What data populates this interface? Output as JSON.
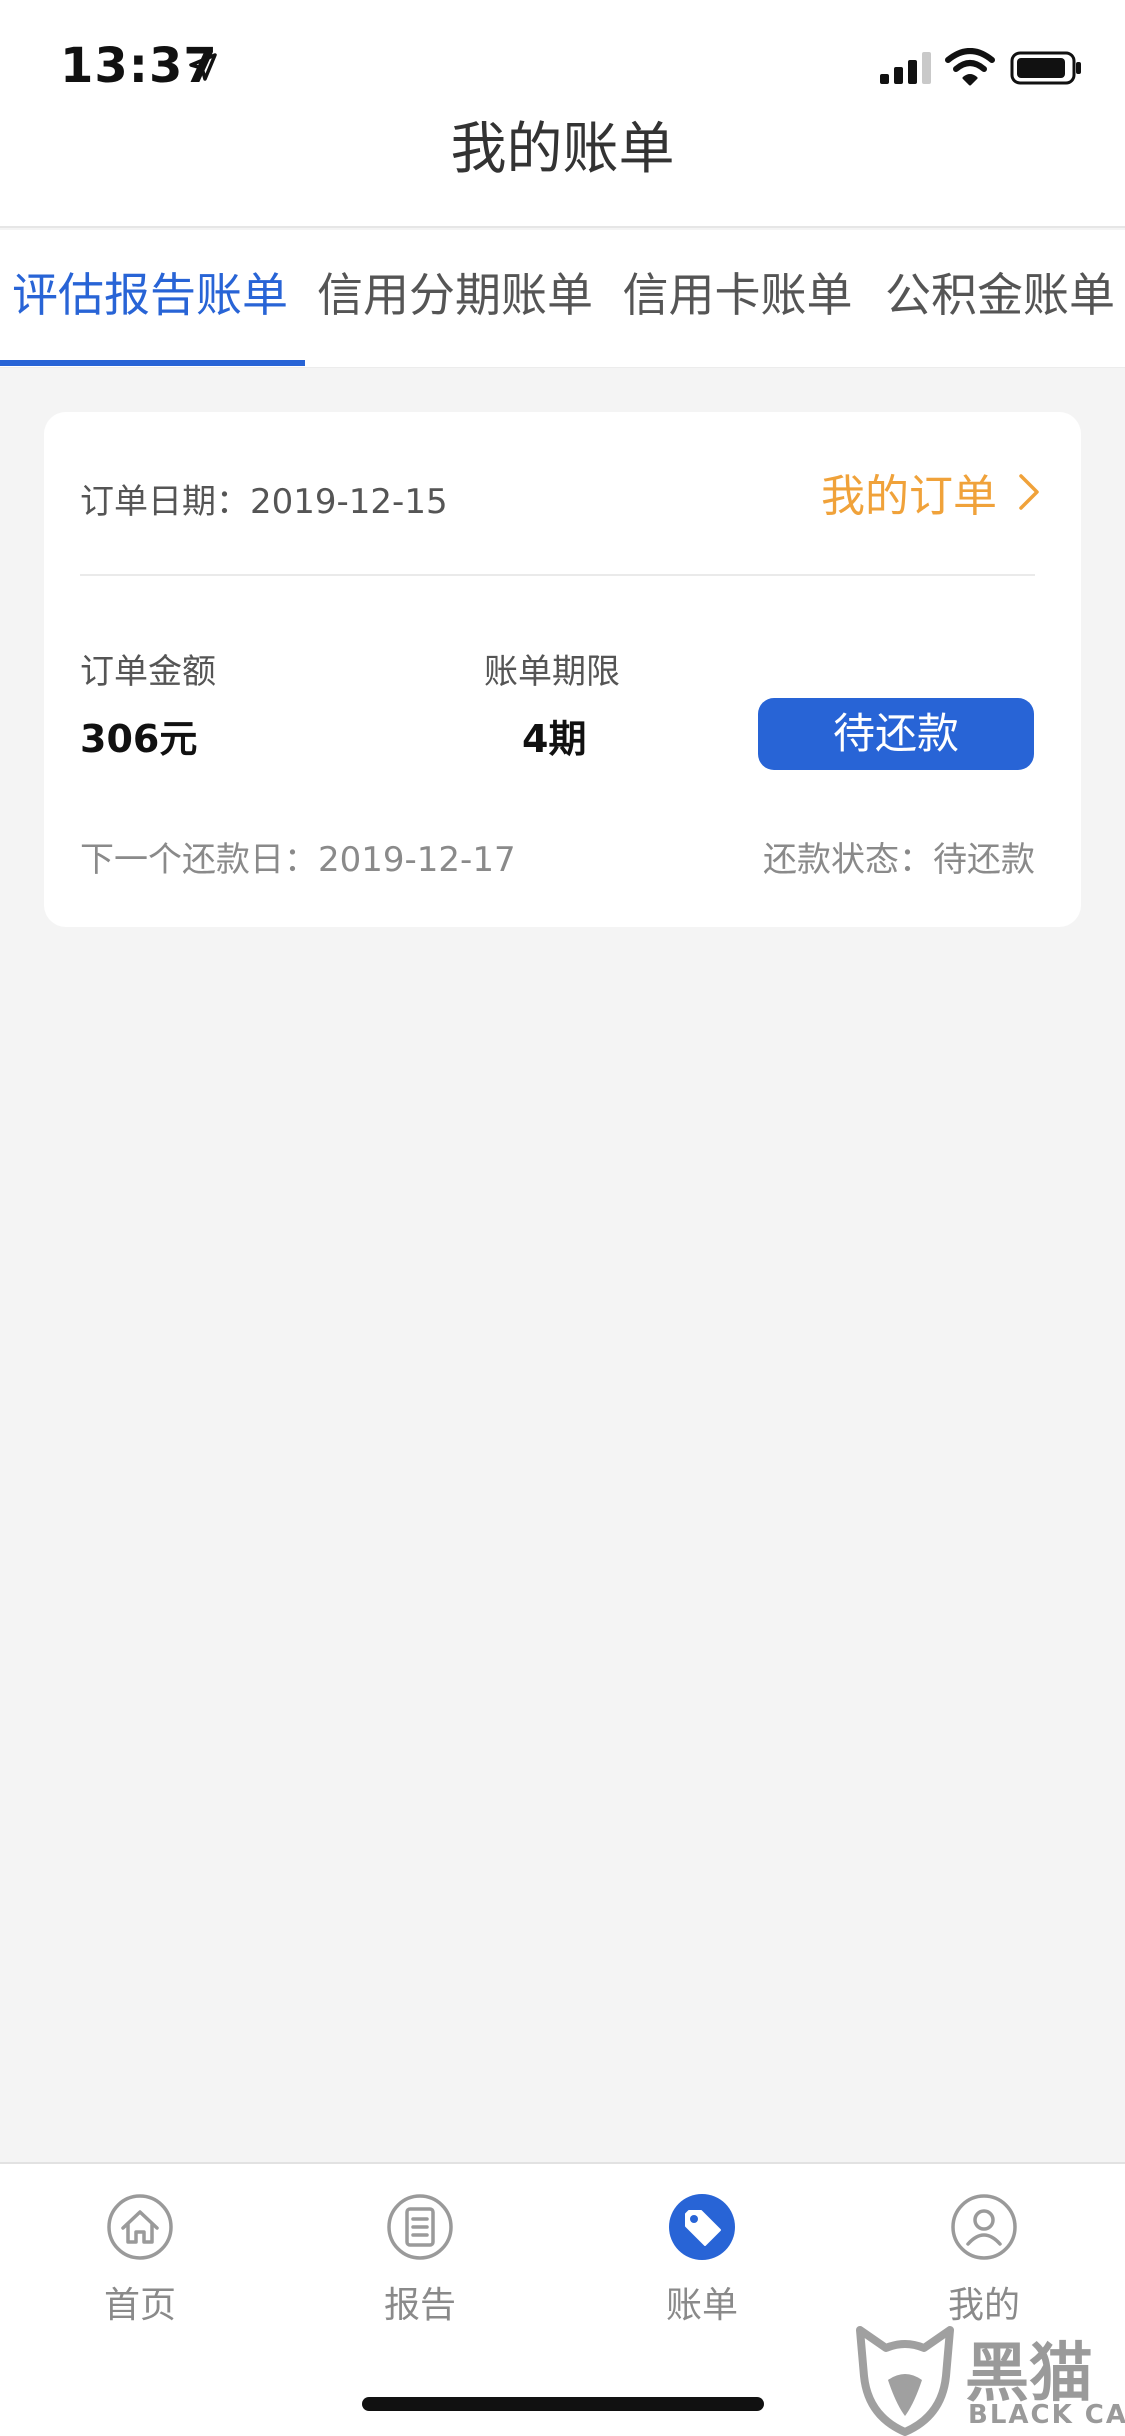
{
  "status_bar": {
    "time": "13:37"
  },
  "header": {
    "title": "我的账单"
  },
  "tabs": [
    {
      "label": "评估报告账单",
      "active": true
    },
    {
      "label": "信用分期账单",
      "active": false
    },
    {
      "label": "信用卡账单",
      "active": false
    },
    {
      "label": "公积金账单",
      "active": false
    }
  ],
  "order_card": {
    "date_label": "订单日期：2019-12-15",
    "my_orders_link": "我的订单",
    "amount_label": "订单金额",
    "amount_value": "306元",
    "term_label": "账单期限",
    "term_value": "4期",
    "pay_button": "待还款",
    "next_date": "下一个还款日：2019-12-17",
    "status": "还款状态：待还款"
  },
  "tabbar": [
    {
      "label": "首页",
      "icon": "home-icon"
    },
    {
      "label": "报告",
      "icon": "report-icon"
    },
    {
      "label": "账单",
      "icon": "bill-tag-icon",
      "active": true
    },
    {
      "label": "我的",
      "icon": "profile-icon"
    }
  ],
  "watermark": {
    "text": "黑猫",
    "sub": "BLACK CAT"
  },
  "colors": {
    "accent": "#2864d6",
    "link": "#f0a23a",
    "background": "#f4f4f4"
  }
}
